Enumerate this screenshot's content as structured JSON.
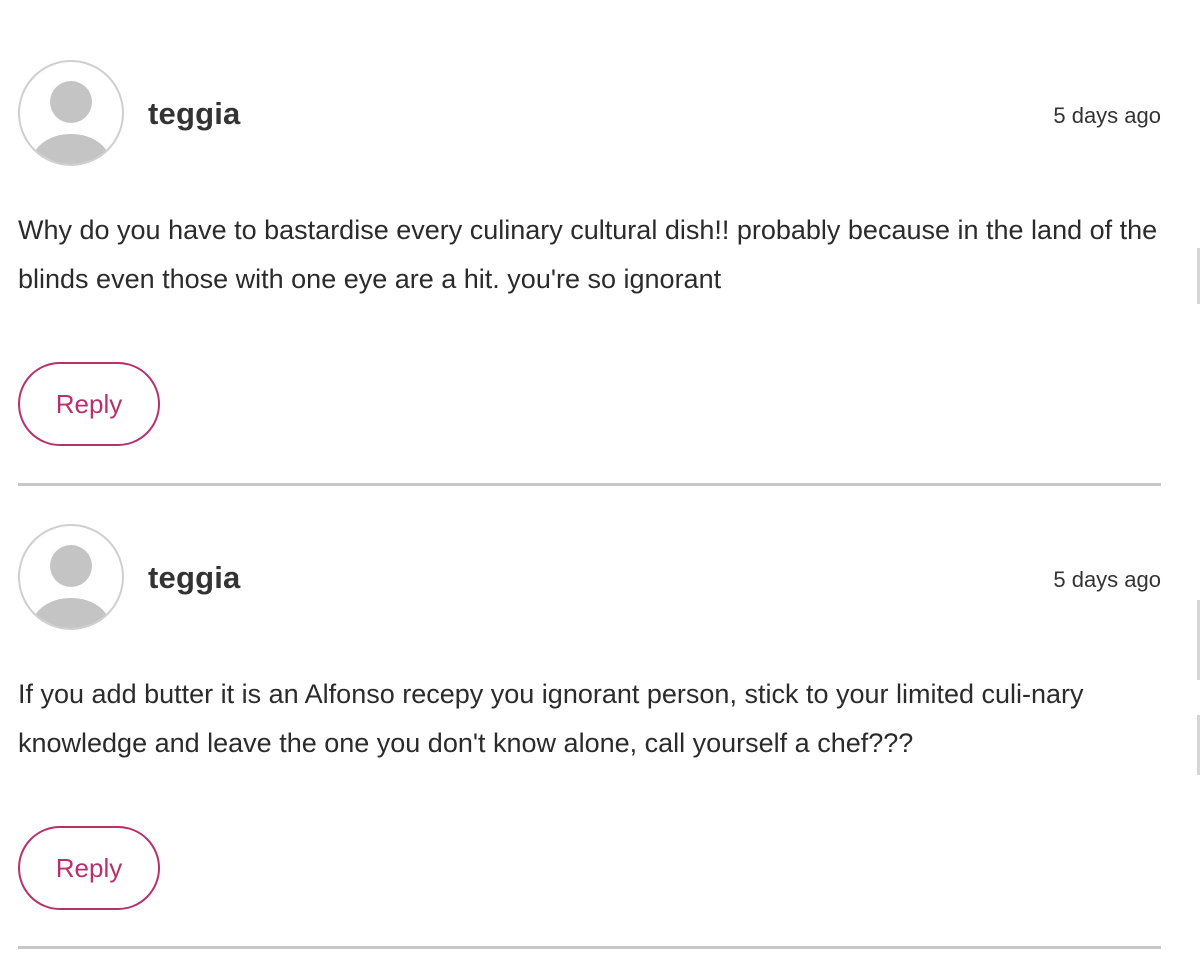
{
  "comments": [
    {
      "author": "teggia",
      "timestamp": "5 days ago",
      "text": "Why do you have to bastardise every culinary cultural dish!! probably because in the land of the blinds even those with one eye are a hit. you're so ignorant",
      "reply_label": "Reply",
      "avatar_icon": "default-user-icon"
    },
    {
      "author": "teggia",
      "timestamp": "5 days ago",
      "text": "If you add butter it is an Alfonso recepy you ignorant person, stick to your limited culi-nary knowledge and leave the one you don't know alone, call yourself a chef???",
      "reply_label": "Reply",
      "avatar_icon": "default-user-icon"
    }
  ],
  "colors": {
    "accent": "#b5326e",
    "divider": "#c8c8c8",
    "avatar_fill": "#c4c4c4",
    "text": "#2b2b2b"
  }
}
